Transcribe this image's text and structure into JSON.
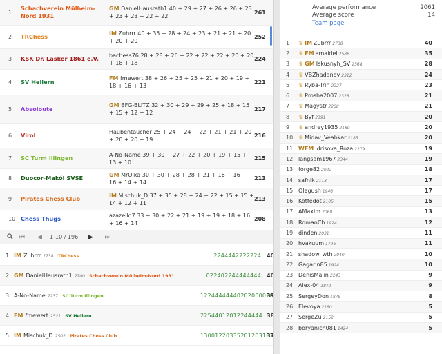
{
  "teams": [
    {
      "rank": "1",
      "name": "Schachverein Mülheim-Nord 1931",
      "color": "#e05a17",
      "title": "GM",
      "player": "DanielHausrath1",
      "points": "40 + 29 + 27 + 26 + 26 + 23 + 23 + 23 + 22 + 22",
      "score": "261"
    },
    {
      "rank": "2",
      "name": "TRChess",
      "color": "#e0811c",
      "title": "IM",
      "player": "Zubrrr",
      "points": "40 + 35 + 28 + 24 + 23 + 21 + 21 + 20 + 20 + 20",
      "score": "252"
    },
    {
      "rank": "3",
      "name": "KSK Dr. Lasker 1861 e.V.",
      "color": "#a01c1c",
      "title": "",
      "player": "bachess76",
      "points": "28 + 28 + 26 + 22 + 22 + 22 + 20 + 20 + 18 + 18",
      "score": "224"
    },
    {
      "rank": "4",
      "name": "SV Hellern",
      "color": "#1a7a3a",
      "title": "FM",
      "player": "fmewert",
      "points": "38 + 26 + 25 + 25 + 21 + 20 + 19 + 18 + 16 + 13",
      "score": "221"
    },
    {
      "rank": "5",
      "name": "Absoloute",
      "color": "#8a3ad6",
      "title": "GM",
      "player": "BFG-BLITZ",
      "points": "32 + 30 + 29 + 29 + 25 + 18 + 15 + 15 + 12 + 12",
      "score": "217"
    },
    {
      "rank": "6",
      "name": "Virol",
      "color": "#c0392b",
      "title": "",
      "player": "Haubentaucher",
      "points": "25 + 24 + 24 + 22 + 21 + 21 + 20 + 20 + 20 + 19",
      "score": "216"
    },
    {
      "rank": "7",
      "name": "SC Turm Illingen",
      "color": "#7cb82f",
      "title": "",
      "player": "A-No-Name",
      "points": "39 + 30 + 27 + 22 + 20 + 19 + 15 + 13 + 10",
      "score": "215"
    },
    {
      "rank": "8",
      "name": "Duocor-Makói SVSE",
      "color": "#1a5e1a",
      "title": "GM",
      "player": "MrOlka",
      "points": "30 + 30 + 28 + 28 + 21 + 16 + 16 + 16 + 14 + 14",
      "score": "213"
    },
    {
      "rank": "9",
      "name": "Pirates Chess Club",
      "color": "#d4691c",
      "title": "IM",
      "player": "Mischuk_D",
      "points": "37 + 35 + 28 + 24 + 22 + 15 + 15 + 14 + 12 + 11",
      "score": "213"
    },
    {
      "rank": "10",
      "name": "Chess Thugs",
      "color": "#2a56c6",
      "title": "",
      "player": "azazello7",
      "points": "33 + 30 + 22 + 21 + 19 + 19 + 18 + 16 + 16 + 14",
      "score": "208"
    }
  ],
  "pager": {
    "range": "1-10 / 196"
  },
  "players": [
    {
      "rank": "1",
      "title": "IM",
      "name": "Zubrrr",
      "rating": "2738",
      "team": "TRChess",
      "team_color": "#e0811c",
      "sequence": "2244442222224",
      "score": "40"
    },
    {
      "rank": "2",
      "title": "GM",
      "name": "DanielHausrath1",
      "rating": "2700",
      "team": "Schachverein Mülheim-Nord 1931",
      "team_color": "#e05a17",
      "sequence": "022402244444444",
      "score": "40"
    },
    {
      "rank": "3",
      "title": "",
      "name": "A-No-Name",
      "rating": "2237",
      "team": "SC Turm Illingen",
      "team_color": "#7cb82f",
      "sequence": "12244444440202000020",
      "score": "39"
    },
    {
      "rank": "4",
      "title": "FM",
      "name": "fmewert",
      "rating": "2521",
      "team": "SV Hellern",
      "team_color": "#1a7a3a",
      "sequence": "22544012012244444",
      "score": "38"
    },
    {
      "rank": "5",
      "title": "IM",
      "name": "Mischuk_D",
      "rating": "2502",
      "team": "Pirates Chess Club",
      "team_color": "#d4691c",
      "sequence": "13001220335201203102123",
      "score": "37"
    }
  ],
  "stats": [
    {
      "label": "Average performance",
      "value": "2061"
    },
    {
      "label": "Average score",
      "value": "14"
    }
  ],
  "team_page": "Team page",
  "ranking": [
    {
      "rank": "1",
      "crown": true,
      "title": "IM",
      "name": "Zubrrr",
      "rating": "2738",
      "score": "40"
    },
    {
      "rank": "2",
      "crown": true,
      "title": "FM",
      "name": "amaidel",
      "rating": "2586",
      "score": "35"
    },
    {
      "rank": "3",
      "crown": true,
      "title": "GM",
      "name": "Iskusnyh_SV",
      "rating": "2568",
      "score": "28"
    },
    {
      "rank": "4",
      "crown": true,
      "title": "",
      "name": "VBZhadanov",
      "rating": "2312",
      "score": "24"
    },
    {
      "rank": "5",
      "crown": true,
      "title": "",
      "name": "Ryba-Trin",
      "rating": "2227",
      "score": "23"
    },
    {
      "rank": "6",
      "crown": true,
      "title": "",
      "name": "Prosha2007",
      "rating": "2328",
      "score": "21"
    },
    {
      "rank": "7",
      "crown": true,
      "title": "",
      "name": "Magystr",
      "rating": "2268",
      "score": "21"
    },
    {
      "rank": "8",
      "crown": true,
      "title": "",
      "name": "Byf",
      "rating": "2391",
      "score": "20"
    },
    {
      "rank": "9",
      "crown": true,
      "title": "",
      "name": "andrey1935",
      "rating": "2180",
      "score": "20"
    },
    {
      "rank": "10",
      "crown": true,
      "title": "",
      "name": "Midav_Veahkar",
      "rating": "2185",
      "score": "20"
    },
    {
      "rank": "11",
      "crown": false,
      "title": "WFM",
      "name": "Idrisova_Roza",
      "rating": "2279",
      "score": "19"
    },
    {
      "rank": "12",
      "crown": false,
      "title": "",
      "name": "langsam1967",
      "rating": "2344",
      "score": "19"
    },
    {
      "rank": "13",
      "crown": false,
      "title": "",
      "name": "forge82",
      "rating": "2022",
      "score": "18"
    },
    {
      "rank": "14",
      "crown": false,
      "title": "",
      "name": "safnik",
      "rating": "2113",
      "score": "17"
    },
    {
      "rank": "15",
      "crown": false,
      "title": "",
      "name": "Olegush",
      "rating": "1946",
      "score": "17"
    },
    {
      "rank": "16",
      "crown": false,
      "title": "",
      "name": "Kotfedot",
      "rating": "2105",
      "score": "15"
    },
    {
      "rank": "17",
      "crown": false,
      "title": "",
      "name": "AMaxim",
      "rating": "2060",
      "score": "13"
    },
    {
      "rank": "18",
      "crown": false,
      "title": "",
      "name": "RomanCh",
      "rating": "1924",
      "score": "12"
    },
    {
      "rank": "19",
      "crown": false,
      "title": "",
      "name": "dinden",
      "rating": "2031",
      "score": "11"
    },
    {
      "rank": "20",
      "crown": false,
      "title": "",
      "name": "hvakuum",
      "rating": "1796",
      "score": "11"
    },
    {
      "rank": "21",
      "crown": false,
      "title": "",
      "name": "shadow_wth",
      "rating": "2040",
      "score": "10"
    },
    {
      "rank": "22",
      "crown": false,
      "title": "",
      "name": "Gagarin85",
      "rating": "1924",
      "score": "10"
    },
    {
      "rank": "23",
      "crown": false,
      "title": "",
      "name": "DenisMalin",
      "rating": "2243",
      "score": "9"
    },
    {
      "rank": "24",
      "crown": false,
      "title": "",
      "name": "Alex-04",
      "rating": "1872",
      "score": "9"
    },
    {
      "rank": "25",
      "crown": false,
      "title": "",
      "name": "SergeyDon",
      "rating": "1878",
      "score": "8"
    },
    {
      "rank": "26",
      "crown": false,
      "title": "",
      "name": "Elevoya",
      "rating": "2180",
      "score": "5"
    },
    {
      "rank": "27",
      "crown": false,
      "title": "",
      "name": "SergeZu",
      "rating": "2152",
      "score": "5"
    },
    {
      "rank": "28",
      "crown": false,
      "title": "",
      "name": "boryanich081",
      "rating": "1424",
      "score": "5"
    }
  ]
}
